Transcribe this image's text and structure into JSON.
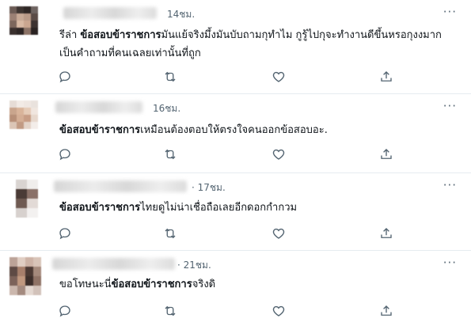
{
  "tweets": [
    {
      "time": "14ชม.",
      "segments": [
        {
          "text": "รีล่า ",
          "bold": false
        },
        {
          "text": "ข้อสอบข้าราชการ",
          "bold": true
        },
        {
          "text": "มันแย้จริงมึ้งมันบับถามกุทำไม กูรู้ไปกุจะทำงานดีขึ้นหรอกุงงมากเป็นคำถามที่คนเฉลยเท่านั้นที่ถูก",
          "bold": false
        }
      ]
    },
    {
      "time": "16ชม.",
      "segments": [
        {
          "text": "ข้อสอบข้าราชการ",
          "bold": true
        },
        {
          "text": "เหมือนต้องตอบให้ตรงใจคนออกข้อสอบอะ.",
          "bold": false
        }
      ]
    },
    {
      "time": "· 17ชม.",
      "segments": [
        {
          "text": "ข้อสอบข้าราชการ",
          "bold": true
        },
        {
          "text": "ไทยดูไม่น่าเชื่อถือเลยอีกดอกกำกวม",
          "bold": false
        }
      ]
    },
    {
      "time": "· 21ชม.",
      "segments": [
        {
          "text": "ขอโทษนะนี่",
          "bold": false
        },
        {
          "text": "ข้อสอบข้าราชการ",
          "bold": true
        },
        {
          "text": "จริงดิ",
          "bold": false
        }
      ]
    }
  ],
  "icons": {
    "more": "more-horizontal-icon",
    "reply": "reply-icon",
    "retweet": "retweet-icon",
    "like": "heart-icon",
    "share": "share-icon"
  },
  "colors": {
    "secondary_text": "#536471",
    "primary_text": "#0f1419",
    "divider": "#e6ecf0"
  }
}
